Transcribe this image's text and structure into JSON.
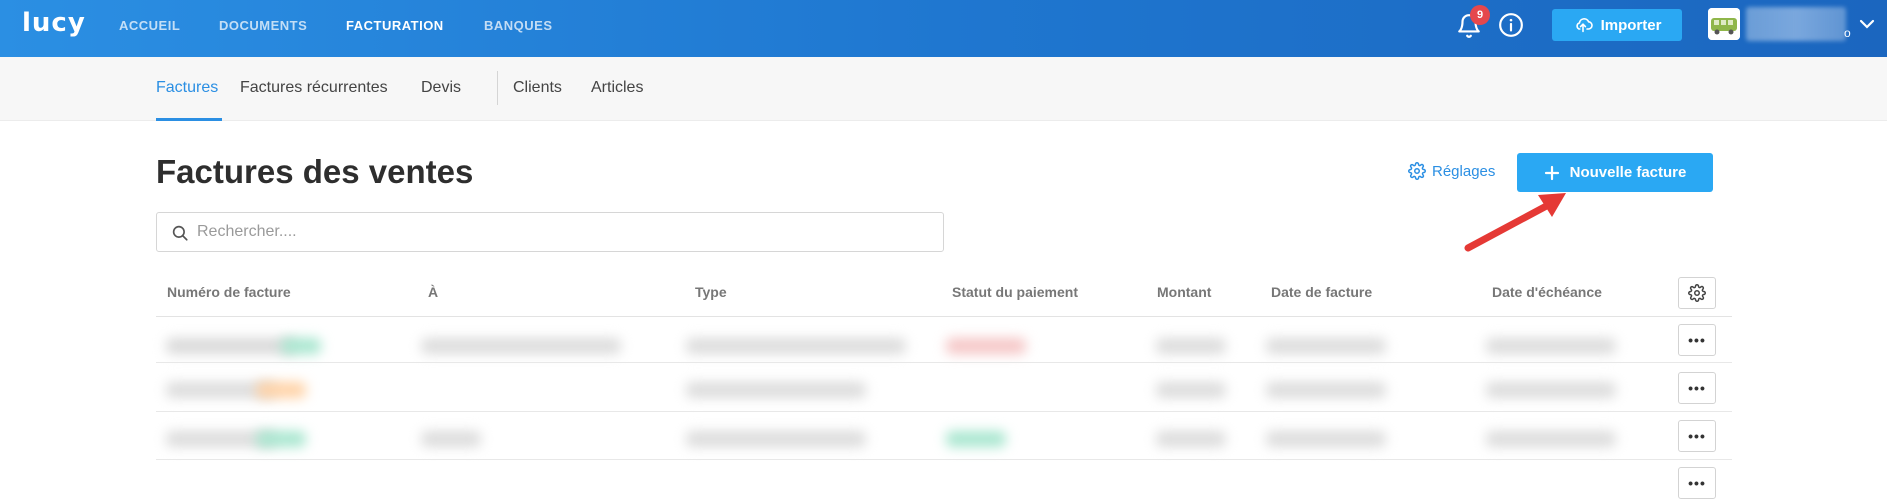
{
  "app": {
    "logo": "lucy"
  },
  "topnav": {
    "items": [
      {
        "label": "ACCUEIL"
      },
      {
        "label": "DOCUMENTS"
      },
      {
        "label": "FACTURATION",
        "active": true
      },
      {
        "label": "BANQUES"
      }
    ],
    "notifications_count": "9",
    "import_label": "Importer",
    "user_suffix": "o"
  },
  "subnav": {
    "items": [
      {
        "label": "Factures",
        "active": true
      },
      {
        "label": "Factures récurrentes"
      },
      {
        "label": "Devis"
      },
      {
        "label": "Clients"
      },
      {
        "label": "Articles"
      }
    ]
  },
  "page": {
    "title": "Factures des ventes",
    "settings_label": "Réglages",
    "new_button_label": "Nouvelle facture"
  },
  "search": {
    "placeholder": "Rechercher...."
  },
  "table": {
    "columns": [
      "Numéro de facture",
      "À",
      "Type",
      "Statut du paiement",
      "Montant",
      "Date de facture",
      "Date d'échéance"
    ],
    "rows_note_blurred": true
  },
  "colors": {
    "topbar": "#1f77d0",
    "accent": "#2b8fe3",
    "button": "#2aa8f3",
    "badge": "#e5484d",
    "arrow": "#e53935"
  }
}
